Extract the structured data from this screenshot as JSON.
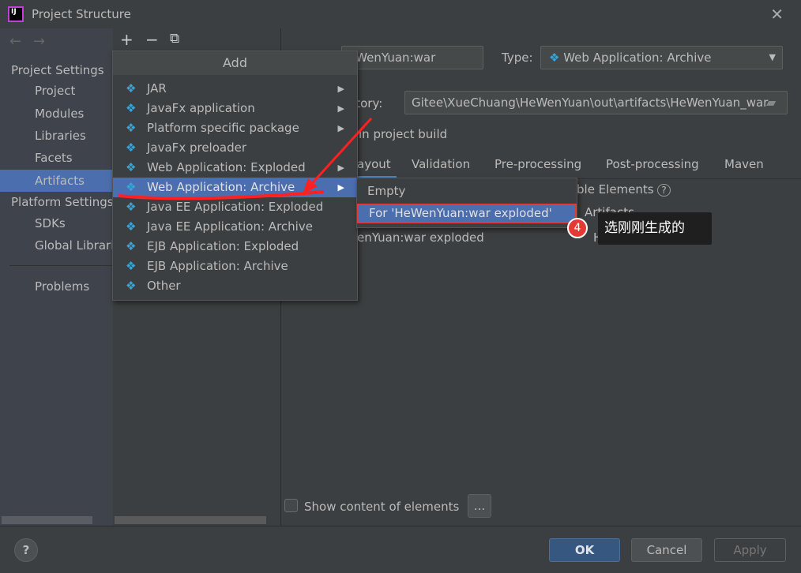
{
  "window": {
    "title": "Project Structure",
    "close": "✕",
    "logo": "IJ"
  },
  "sidebar": {
    "back": "←",
    "forward": "→",
    "project_settings": "Project Settings",
    "items": [
      "Project",
      "Modules",
      "Libraries",
      "Facets",
      "Artifacts"
    ],
    "selected": "Artifacts",
    "platform_settings": "Platform Settings",
    "platform_items": [
      "SDKs",
      "Global Libraries"
    ],
    "problems": "Problems"
  },
  "toolbar": {
    "add": "+",
    "remove": "−",
    "copy": "⧉"
  },
  "add_menu": {
    "title": "Add",
    "items": [
      {
        "label": "JAR",
        "submenu": true
      },
      {
        "label": "JavaFx application",
        "submenu": true
      },
      {
        "label": "Platform specific package",
        "submenu": true
      },
      {
        "label": "JavaFx preloader",
        "submenu": false
      },
      {
        "label": "Web Application: Exploded",
        "submenu": true
      },
      {
        "label": "Web Application: Archive",
        "submenu": true
      },
      {
        "label": "Java EE Application: Exploded",
        "submenu": false
      },
      {
        "label": "Java EE Application: Archive",
        "submenu": false
      },
      {
        "label": "EJB Application: Exploded",
        "submenu": false
      },
      {
        "label": "EJB Application: Archive",
        "submenu": false
      },
      {
        "label": "Other",
        "submenu": false
      }
    ],
    "selected": "Web Application: Archive"
  },
  "submenu": {
    "items": [
      "Empty",
      "For 'HeWenYuan:war exploded'"
    ],
    "selected": "For 'HeWenYuan:war exploded'"
  },
  "artifact": {
    "name": "eWenYuan:war",
    "type_label": "Type:",
    "type_value": "Web Application: Archive",
    "dir_label": "ctory:",
    "dir_value": "Gitee\\XueChuang\\HeWenYuan\\out\\artifacts\\HeWenYuan_war",
    "build_label": "in project build",
    "tabs": [
      "ayout",
      "Validation",
      "Pre-processing",
      "Post-processing",
      "Maven"
    ],
    "available_elements": "ble Elements",
    "tree_artifacts": "Artifacts",
    "tree_item": "enYuan:war exploded",
    "tree_item2": "He",
    "show_content": "Show content of elements",
    "more": "..."
  },
  "annotation": {
    "step": "4",
    "note": "选刚刚生成的",
    "color": "#e53935"
  },
  "footer": {
    "help": "?",
    "ok": "OK",
    "cancel": "Cancel",
    "apply": "Apply"
  },
  "colors": {
    "selection": "#4b6eaf",
    "background": "#3c3f41",
    "ok": "#365880"
  }
}
